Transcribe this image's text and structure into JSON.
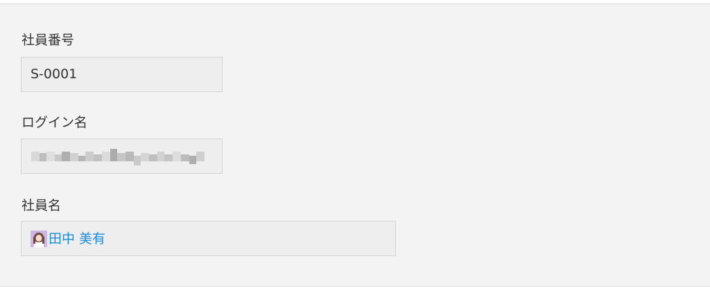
{
  "form": {
    "employee_id": {
      "label": "社員番号",
      "value": "S-0001"
    },
    "login_name": {
      "label": "ログイン名",
      "value_redacted": true
    },
    "employee_name": {
      "label": "社員名",
      "value": "田中 美有",
      "avatar_icon": "user-avatar-icon"
    }
  },
  "colors": {
    "panel_background": "#f3f3f3",
    "field_background": "#eeeeee",
    "field_border": "#d4d4d4",
    "link": "#1a8bd8",
    "text": "#333333"
  }
}
